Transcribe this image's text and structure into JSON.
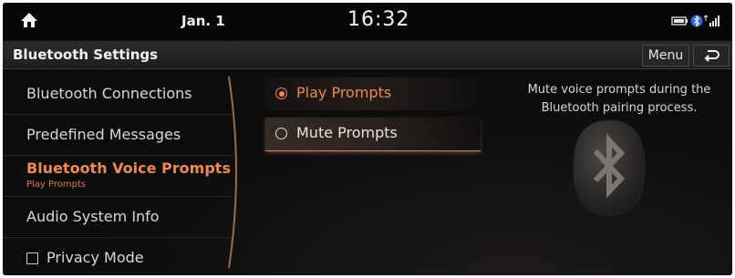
{
  "status": {
    "date": "Jan. 1",
    "time": "16:32",
    "icons": [
      "home-icon",
      "battery-icon",
      "bluetooth-icon",
      "signal-icon"
    ]
  },
  "header": {
    "title": "Bluetooth Settings",
    "menu_label": "Menu",
    "back_icon": "back-arrow-icon"
  },
  "sidebar": {
    "items": [
      {
        "label": "Bluetooth Connections"
      },
      {
        "label": "Predefined Messages"
      },
      {
        "label": "Bluetooth Voice Prompts",
        "sublabel": "Play Prompts",
        "active": true
      },
      {
        "label": "Audio System Info"
      },
      {
        "label": "Privacy Mode",
        "checked": false
      }
    ]
  },
  "main": {
    "options": [
      {
        "label": "Play Prompts",
        "selected": true
      },
      {
        "label": "Mute Prompts",
        "selected": false
      }
    ],
    "description": "Mute voice prompts during the Bluetooth pairing process.",
    "emblem_icon": "bluetooth-icon"
  },
  "colors": {
    "accent": "#f08a4a",
    "background": "#0b0b0c",
    "text": "#e8e8e8"
  }
}
